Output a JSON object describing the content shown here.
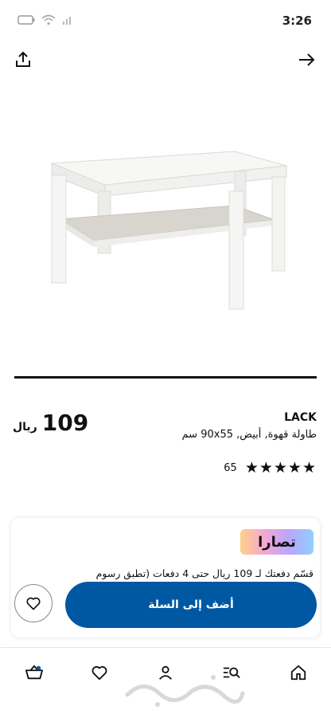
{
  "status_bar": {
    "time": "3:26"
  },
  "product": {
    "name": "LACK",
    "description": "طاولة قهوة, أبيض, 90x55 سم",
    "price_value": "109",
    "price_currency": "ريال",
    "rating_count": "65",
    "rating_stars": "★★★★★",
    "rating_score": 5,
    "carousel_progress": 1.0
  },
  "installments": {
    "brand_label": "تصارا",
    "text": "قسّم دفعتك لـ 109 ريال حتى 4 دفعات (تطبق رسوم"
  },
  "actions": {
    "add_to_cart_label": "أضف إلى السلة"
  },
  "bottom_nav": {
    "items": [
      {
        "icon": "home-icon"
      },
      {
        "icon": "search-list-icon"
      },
      {
        "icon": "profile-icon"
      },
      {
        "icon": "heart-icon"
      },
      {
        "icon": "cart-icon"
      }
    ]
  },
  "colors": {
    "primary": "#0058a3",
    "text": "#111111"
  }
}
